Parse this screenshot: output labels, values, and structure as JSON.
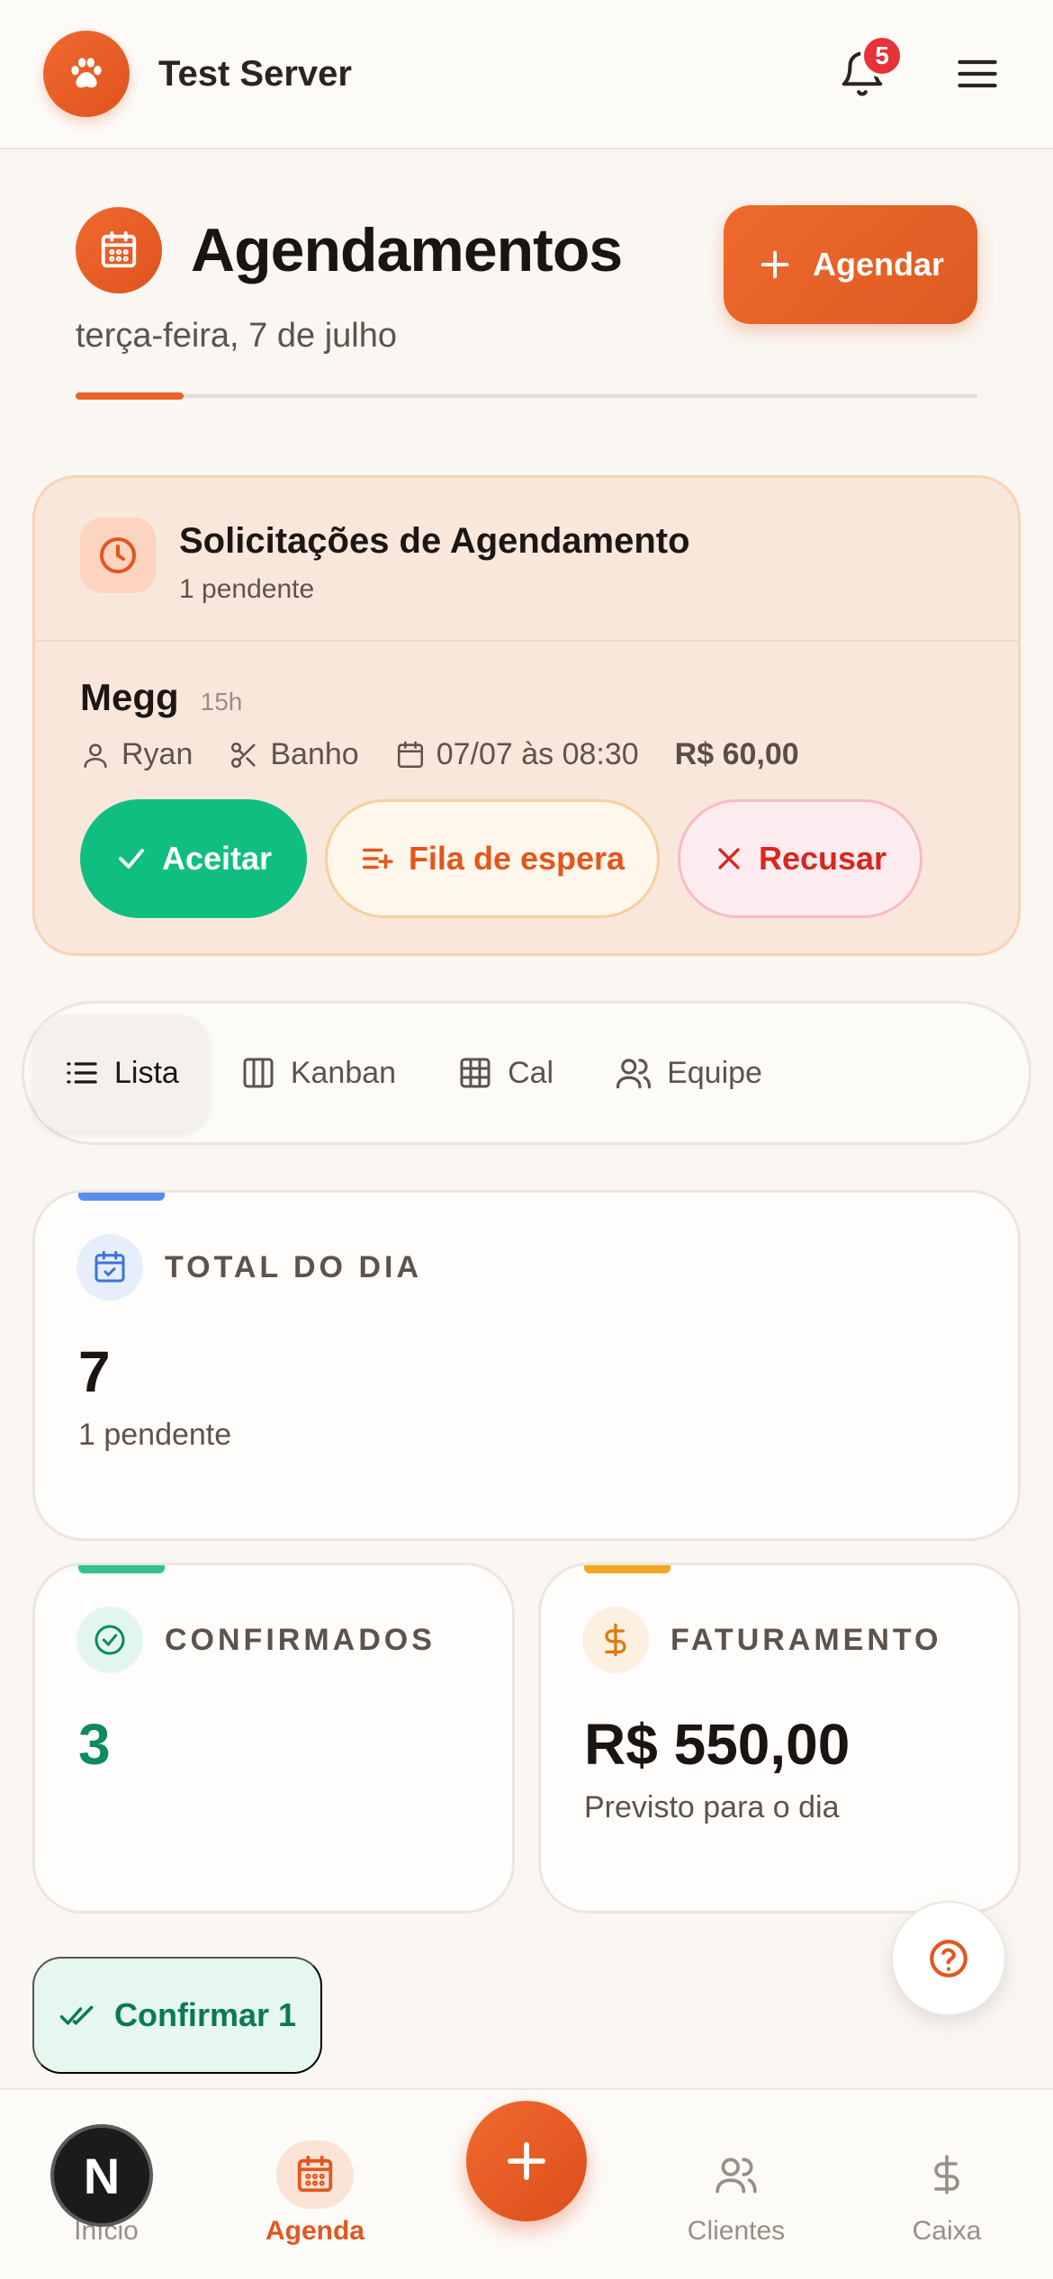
{
  "header": {
    "server_name": "Test Server",
    "notification_count": "5",
    "icons": {
      "logo": "paw-icon",
      "bell": "bell-icon",
      "menu": "hamburger-icon"
    }
  },
  "page": {
    "title": "Agendamentos",
    "date": "terça-feira, 7 de julho",
    "schedule_button": "Agendar",
    "scroll_progress": 0.12
  },
  "requests": {
    "title": "Solicitações de Agendamento",
    "pending": "1 pendente",
    "item": {
      "client": "Megg",
      "ago": "15h",
      "pet": "Ryan",
      "service": "Banho",
      "datetime": "07/07 às 08:30",
      "price": "R$ 60,00"
    },
    "actions": {
      "accept": "Aceitar",
      "waitlist": "Fila de espera",
      "refuse": "Recusar"
    }
  },
  "view_tabs": [
    {
      "label": "Lista",
      "active": true
    },
    {
      "label": "Kanban",
      "active": false
    },
    {
      "label": "Cal",
      "active": false
    },
    {
      "label": "Equipe",
      "active": false
    }
  ],
  "stats": {
    "total": {
      "label": "TOTAL DO DIA",
      "value": "7",
      "note": "1 pendente",
      "accent": "#5b8def"
    },
    "confirmed": {
      "label": "CONFIRMADOS",
      "value": "3",
      "accent": "#34c38f",
      "value_color": "#0d8a5f"
    },
    "revenue": {
      "label": "FATURAMENTO",
      "value": "R$ 550,00",
      "note": "Previsto para o dia",
      "accent": "#f5a623"
    }
  },
  "confirm_button": "Confirmar 1",
  "bottom_nav": [
    {
      "label": "Início",
      "active": false
    },
    {
      "label": "Agenda",
      "active": true
    },
    {
      "label": "Clientes",
      "active": false
    },
    {
      "label": "Caixa",
      "active": false
    }
  ],
  "dev_badge": "N",
  "colors": {
    "brand": "#e8622a",
    "success": "#10bf80",
    "danger": "#d9261f",
    "background": "#faf6f1"
  }
}
